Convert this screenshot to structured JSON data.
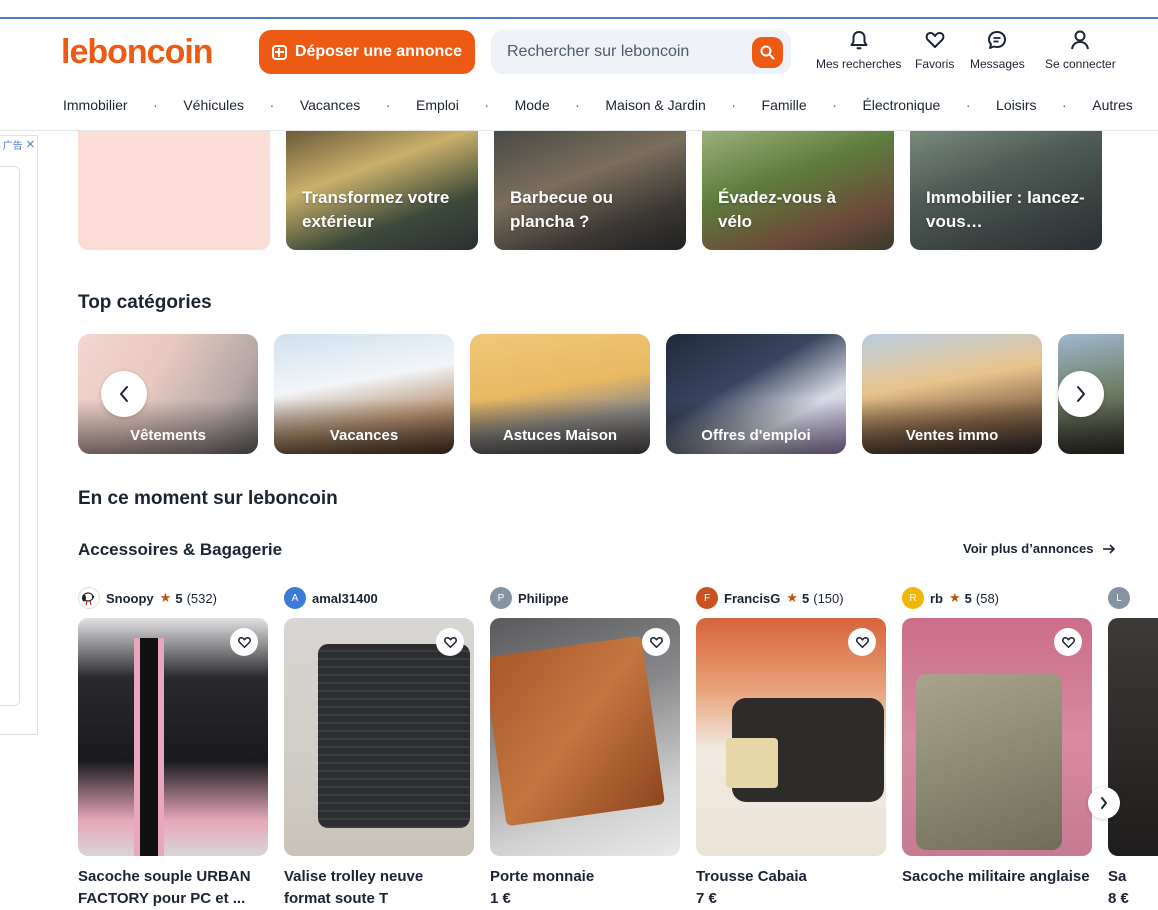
{
  "header": {
    "logo": "leboncoin",
    "deposit_label": "Déposer une annonce",
    "search_placeholder": "Rechercher sur leboncoin",
    "actions": [
      {
        "label": "Mes recherches",
        "icon": "bell-icon"
      },
      {
        "label": "Favoris",
        "icon": "heart-icon"
      },
      {
        "label": "Messages",
        "icon": "message-icon"
      },
      {
        "label": "Se connecter",
        "icon": "user-icon"
      }
    ],
    "categories": [
      "Immobilier",
      "Véhicules",
      "Vacances",
      "Emploi",
      "Mode",
      "Maison & Jardin",
      "Famille",
      "Électronique",
      "Loisirs",
      "Autres"
    ]
  },
  "ad": {
    "tag": "广告"
  },
  "promos": [
    {
      "text": ""
    },
    {
      "text": "Transformez votre extérieur"
    },
    {
      "text": "Barbecue ou plancha ?"
    },
    {
      "text": "Évadez-vous à vélo"
    },
    {
      "text": "Immobilier : lancez-vous…"
    }
  ],
  "top_categories": {
    "title": "Top catégories",
    "items": [
      "Vêtements",
      "Vacances",
      "Astuces Maison",
      "Offres d'emploi",
      "Ventes immo"
    ]
  },
  "moment": {
    "title": "En ce moment sur leboncoin",
    "subsection": "Accessoires & Bagagerie",
    "see_more": "Voir plus d’annonces",
    "listings": [
      {
        "seller": "Snoopy",
        "rating": "5",
        "count": "(532)",
        "avatar": "",
        "title": "Sacoche souple URBAN FACTORY pour PC et ...",
        "price": ""
      },
      {
        "seller": "amal31400",
        "rating": "",
        "count": "",
        "avatar": "A",
        "title": "Valise trolley neuve format soute T",
        "price": ""
      },
      {
        "seller": "Philippe",
        "rating": "",
        "count": "",
        "avatar": "P",
        "title": "Porte monnaie",
        "price": "1 €"
      },
      {
        "seller": "FrancisG",
        "rating": "5",
        "count": "(150)",
        "avatar": "F",
        "title": "Trousse Cabaia",
        "price": "7 €"
      },
      {
        "seller": "rb",
        "rating": "5",
        "count": "(58)",
        "avatar": "R",
        "title": "Sacoche militaire anglaise",
        "price": ""
      },
      {
        "seller": "",
        "rating": "",
        "count": "",
        "avatar": "L",
        "title": "Sa",
        "price": "8 €"
      }
    ]
  },
  "colors": {
    "brand": "#ec5a13",
    "text": "#1a2433",
    "star": "#c0510f"
  }
}
